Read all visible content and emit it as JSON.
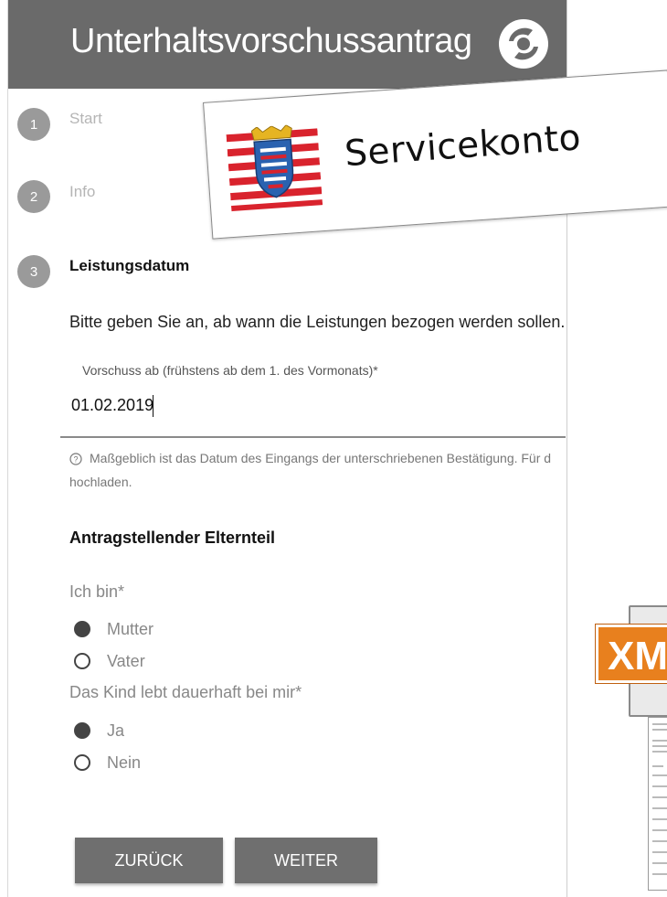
{
  "header": {
    "title": "Unterhaltsvorschussantrag"
  },
  "steps": [
    {
      "number": "1",
      "label": "Start"
    },
    {
      "number": "2",
      "label": "Info"
    },
    {
      "number": "3",
      "label": "Leistungsdatum"
    }
  ],
  "form": {
    "instruction": "Bitte geben Sie an, ab wann die Leistungen bezogen werden sollen.",
    "date_field": {
      "label": "Vorschuss ab (frühstens ab dem 1. des Vormonats)*",
      "value": "01.02.2019"
    },
    "hint_line1": "Maßgeblich ist das Datum des Eingangs der unterschriebenen Bestätigung. Für d",
    "hint_line2": "hochladen.",
    "section_title": "Antragstellender Elternteil",
    "question1": {
      "label": "Ich bin*",
      "options": [
        {
          "label": "Mutter",
          "checked": true
        },
        {
          "label": "Vater",
          "checked": false
        }
      ]
    },
    "question2": {
      "label": "Das Kind lebt dauerhaft bei mir*",
      "options": [
        {
          "label": "Ja",
          "checked": true
        },
        {
          "label": "Nein",
          "checked": false
        }
      ]
    }
  },
  "buttons": {
    "back": "ZURÜCK",
    "next": "WEITER"
  },
  "overlay": {
    "servicekonto": "Servicekonto",
    "xml_tag": "XML"
  },
  "colors": {
    "header_bg": "#6a6a6a",
    "button_bg": "#6f6f6f",
    "step_dot": "#9a9a9a",
    "xml_orange": "#e8801e",
    "flag_red": "#d9232d"
  }
}
